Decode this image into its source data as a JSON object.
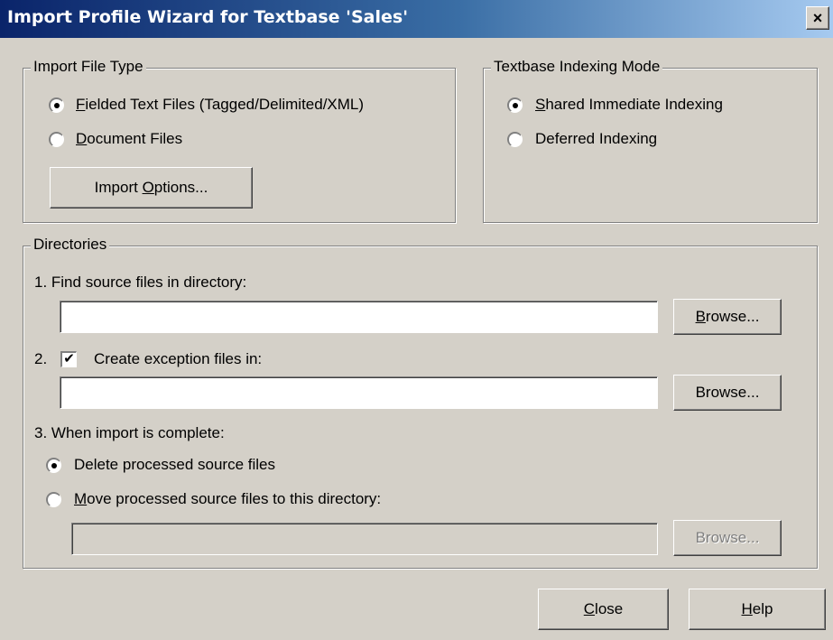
{
  "window": {
    "title": "Import Profile Wizard for Textbase 'Sales'",
    "close_glyph": "×"
  },
  "import_file_type": {
    "legend": "Import File Type",
    "options": [
      {
        "label": "Fielded Text Files (Tagged/Delimited/XML)",
        "checked": true
      },
      {
        "label": "Document Files",
        "checked": false
      }
    ],
    "import_options_button": "Import Options..."
  },
  "indexing_mode": {
    "legend": "Textbase Indexing Mode",
    "options": [
      {
        "label": "Shared Immediate Indexing",
        "checked": true
      },
      {
        "label": "Deferred Indexing",
        "checked": false
      }
    ]
  },
  "directories": {
    "legend": "Directories",
    "source_label": "1. Find source files in directory:",
    "source_value": "",
    "exception_prefix": "2.",
    "exception_checked": true,
    "exception_label": "Create exception files in:",
    "exception_value": "",
    "complete_label": "3. When import is complete:",
    "delete_label": "Delete processed source files",
    "delete_checked": true,
    "move_label": "Move processed source files to this directory:",
    "move_checked": false,
    "move_value": "",
    "browse_label": "Browse...",
    "check_glyph": "✔"
  },
  "footer": {
    "close_label": "Close",
    "help_label": "Help"
  }
}
